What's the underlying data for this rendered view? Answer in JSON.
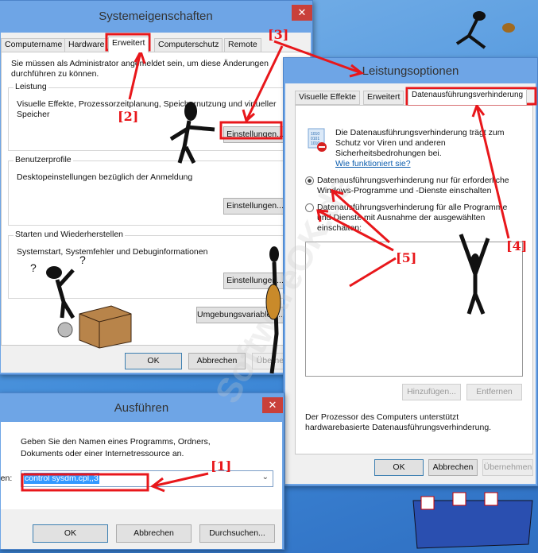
{
  "system_properties": {
    "title": "Systemeigenschaften",
    "close": "✕",
    "tabs": [
      "Computername",
      "Hardware",
      "Erweitert",
      "Computerschutz",
      "Remote"
    ],
    "active_tab": "Erweitert",
    "admin_note_1": "Sie müssen als Administrator angemeldet sein, um diese Änderungen",
    "admin_note_2": "durchführen zu können.",
    "performance": {
      "legend": "Leistung",
      "desc_1": "Visuelle Effekte, Prozessorzeitplanung, Speichernutzung und virtueller",
      "desc_2": "Speicher",
      "button": "Einstellungen..."
    },
    "user_profiles": {
      "legend": "Benutzerprofile",
      "desc": "Desktopeinstellungen bezüglich der Anmeldung",
      "button": "Einstellungen..."
    },
    "startup": {
      "legend": "Starten und Wiederherstellen",
      "desc": "Systemstart, Systemfehler und Debuginformationen",
      "button": "Einstellungen..."
    },
    "env_button": "Umgebungsvariablen...",
    "ok": "OK",
    "cancel": "Abbrechen",
    "apply": "Übernehmen"
  },
  "performance_options": {
    "title": "Leistungsoptionen",
    "tabs": [
      "Visuelle Effekte",
      "Erweitert",
      "Datenausführungsverhinderung"
    ],
    "active_tab": "Datenausführungsverhinderung",
    "intro_1": "Die Datenausführungsverhinderung trägt zum Schutz",
    "intro_2": "vor Viren und anderen Sicherheitsbedrohungen bei.",
    "help_link": "Wie funktioniert sie?",
    "radio_1_a": "Datenausführungsverhinderung nur für erforderliche",
    "radio_1_b": "Windows-Programme und -Dienste einschalten",
    "radio_2_a": "Datenausführungsverhinderung für alle Programme und",
    "radio_2_b": "Dienste mit Ausnahme der ausgewählten einschalten:",
    "selected_radio": 1,
    "add": "Hinzufügen...",
    "remove": "Entfernen",
    "cpu_note_1": "Der Prozessor des Computers unterstützt hardwarebasierte",
    "cpu_note_2": "Datenausführungsverhinderung.",
    "ok": "OK",
    "cancel": "Abbrechen",
    "apply": "Übernehmen"
  },
  "run_dialog": {
    "title": "Ausführen",
    "close": "✕",
    "prompt_1": "Geben Sie den Namen eines Programms, Ordners,",
    "prompt_2": "Dokuments oder einer Internetressource an.",
    "open_label": "Öffnen:",
    "input_value": "control sysdm.cpl,,3",
    "ok": "OK",
    "cancel": "Abbrechen",
    "browse": "Durchsuchen..."
  },
  "annotations": [
    "[1]",
    "[2]",
    "[3]",
    "[4]",
    "[5]"
  ],
  "watermark": "SoftwareOK.de",
  "colors": {
    "accent_red": "#e8171b",
    "title_bar": "#6ea5e6",
    "close_red": "#c9403a",
    "selection": "#3399ff"
  }
}
